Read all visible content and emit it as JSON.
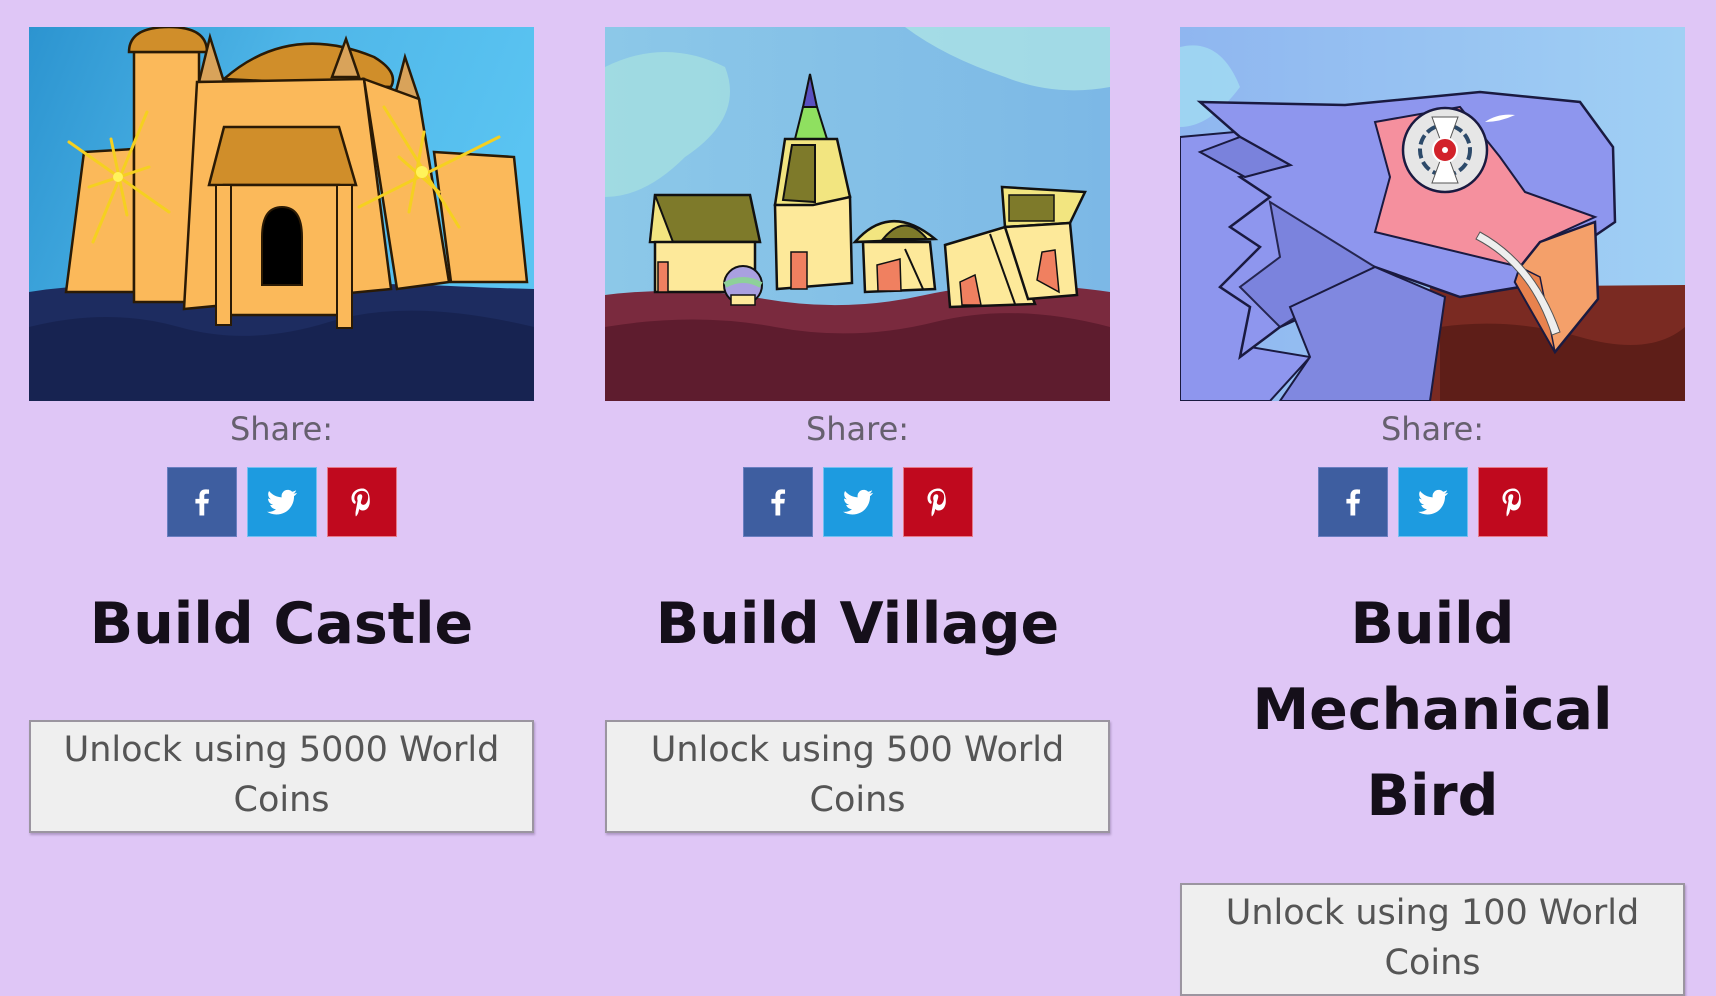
{
  "share_label": "Share:",
  "share_buttons": {
    "facebook": {
      "label": "f",
      "color": "#3e5ea0"
    },
    "twitter": {
      "color": "#1d9be0"
    },
    "pinterest": {
      "color": "#c0091e"
    }
  },
  "cards": [
    {
      "title": "Build Castle",
      "illustration": "castle",
      "unlock_label": "Unlock using 5000 World Coins",
      "cost": 5000,
      "currency": "World Coins"
    },
    {
      "title": "Build Village",
      "illustration": "village",
      "unlock_label": "Unlock using 500 World Coins",
      "cost": 500,
      "currency": "World Coins"
    },
    {
      "title": "Build Mechanical Bird",
      "illustration": "mechanical-bird",
      "unlock_label": "Unlock using 100 World Coins",
      "cost": 100,
      "currency": "World Coins"
    }
  ],
  "colors": {
    "background": "#dfc6f6",
    "button_bg": "#efefef",
    "title": "#150f1a"
  }
}
